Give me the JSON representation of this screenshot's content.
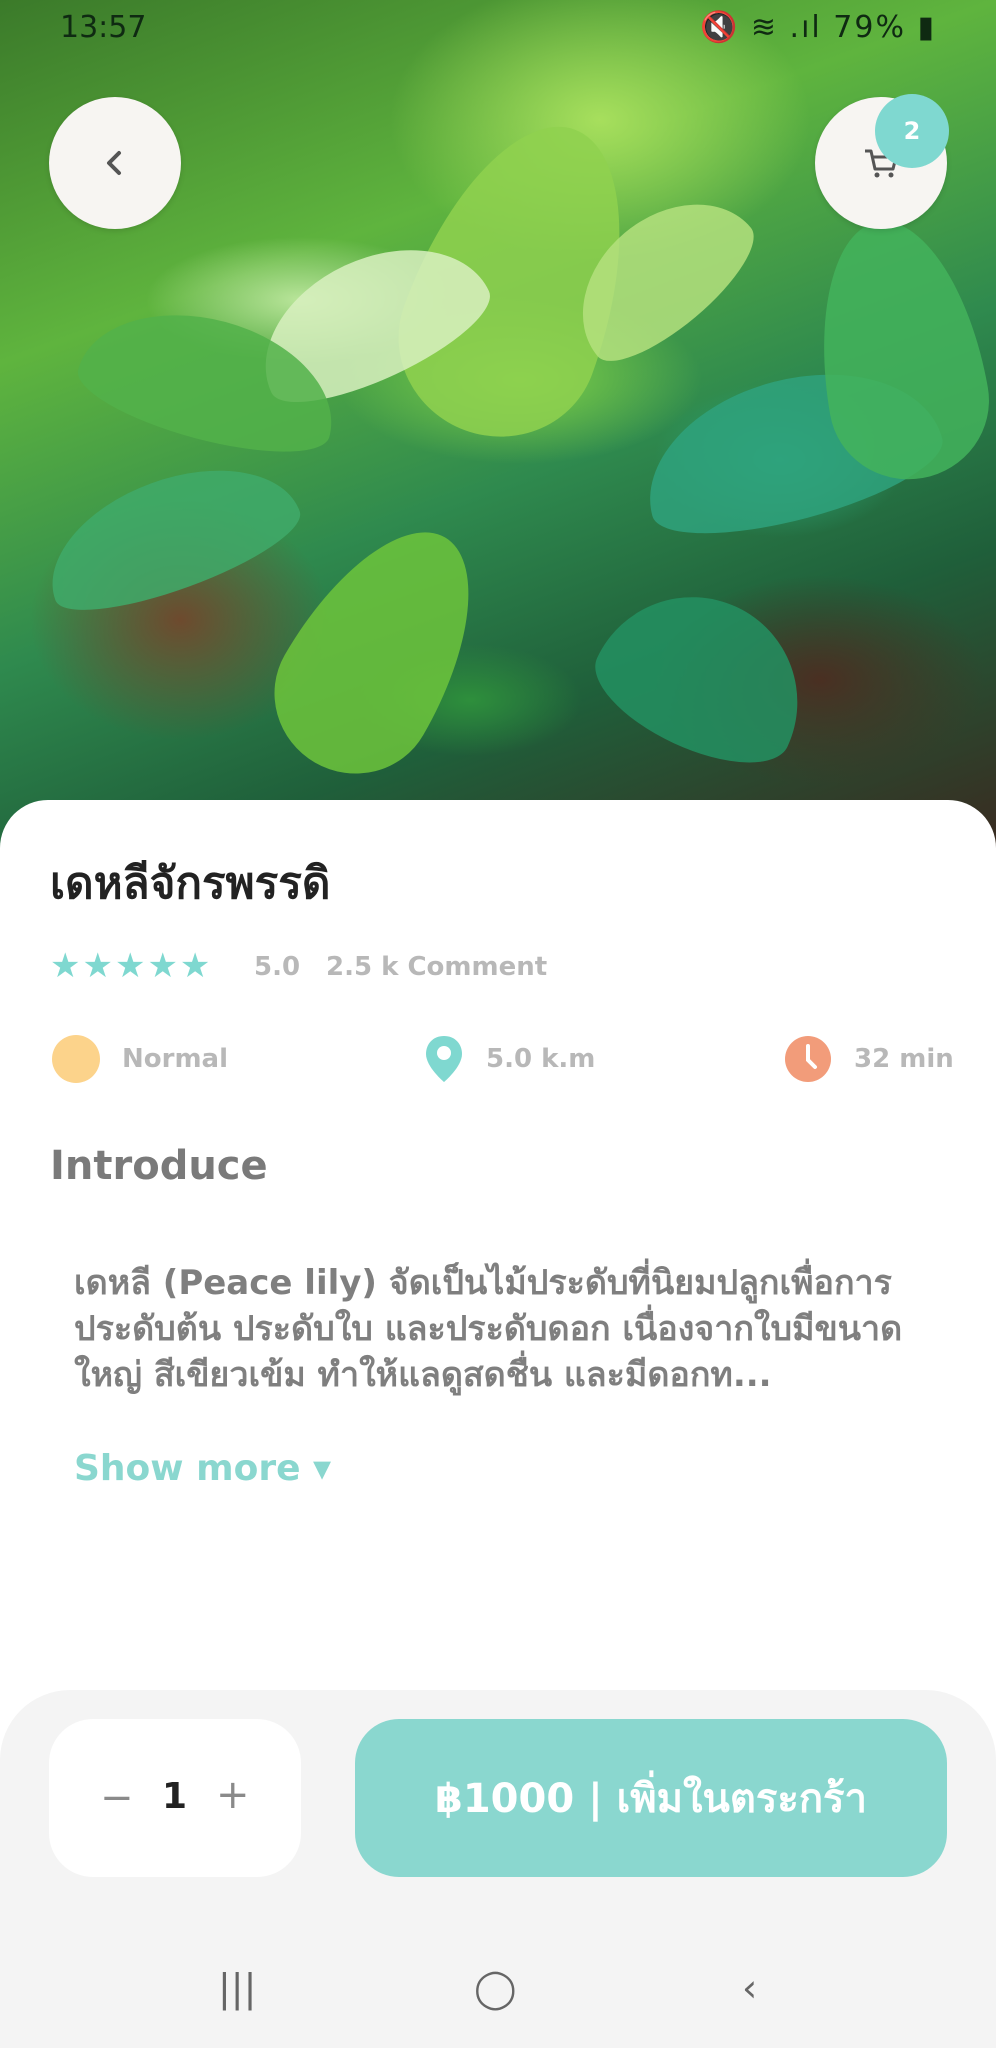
{
  "status_bar": {
    "time": "13:57",
    "icons_text": "🔇 ≋ .ıl 79% ▮"
  },
  "header": {
    "back_icon": "chevron-left-icon",
    "cart_icon": "cart-icon",
    "cart_count": "2"
  },
  "product": {
    "name": "เดหลีจักรพรรดิ",
    "rating_stars": "★★★★★",
    "rating": "5.0",
    "comments": "2.5 k Comment",
    "info": [
      {
        "icon": "circle-icon",
        "label": "Normal",
        "color": "#fcd38b"
      },
      {
        "icon": "location-pin-icon",
        "label": "5.0 k.m",
        "color": "#7fd8d0"
      },
      {
        "icon": "clock-icon",
        "label": "32 min",
        "color": "#f29c7a"
      }
    ],
    "intro_heading": "Introduce",
    "description": "เดหลี (Peace lily) จัดเป็นไม้ประดับที่นิยมปลูกเพื่อการประดับต้น ประดับใบ และประดับดอก เนื่องจากใบมีขนาดใหญ่ สีเขียวเข้ม ทำให้แลดูสดชื่น และมีดอกท...",
    "show_more": "Show more ▾"
  },
  "cart_bar": {
    "minus": "−",
    "quantity": "1",
    "plus": "+",
    "add_label": "฿1000 | เพิ่มในตระกร้า"
  },
  "nav": {
    "recent": "|||",
    "home": "◯",
    "back": "‹"
  },
  "colors": {
    "accent": "#8ad7cf",
    "text_gray": "#7f7f7f"
  }
}
